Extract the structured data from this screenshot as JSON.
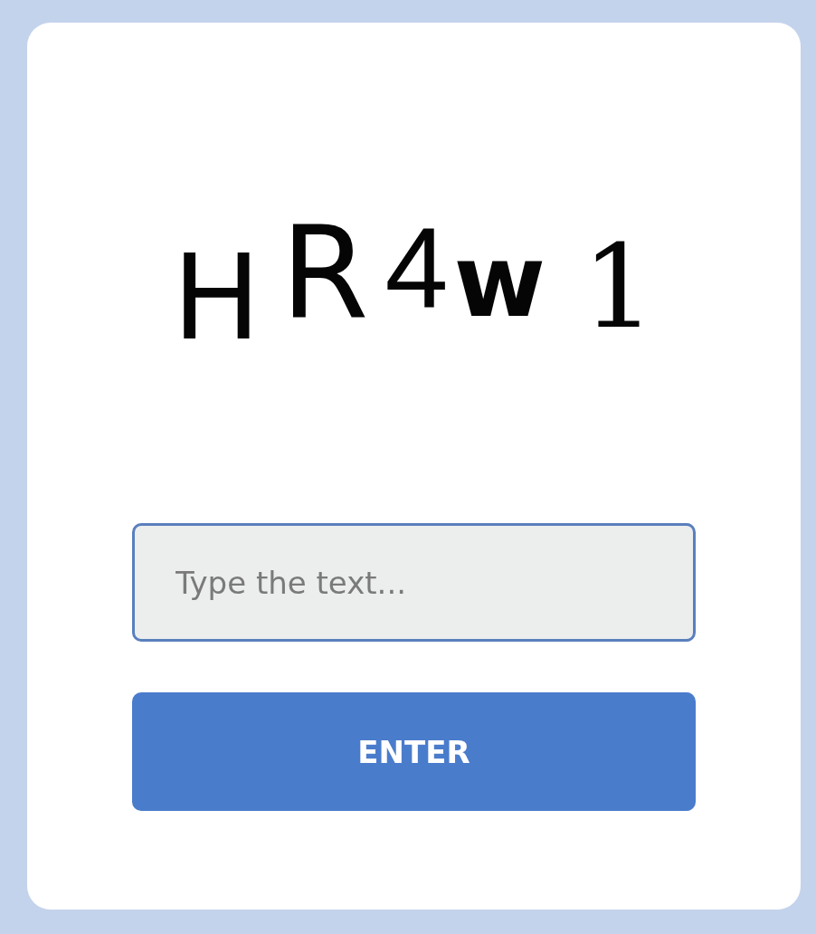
{
  "captcha": {
    "characters": [
      "H",
      "R",
      "4",
      "w",
      "1"
    ]
  },
  "answer_field": {
    "placeholder": "Type the text..."
  },
  "submit_button": {
    "label": "ENTER"
  }
}
